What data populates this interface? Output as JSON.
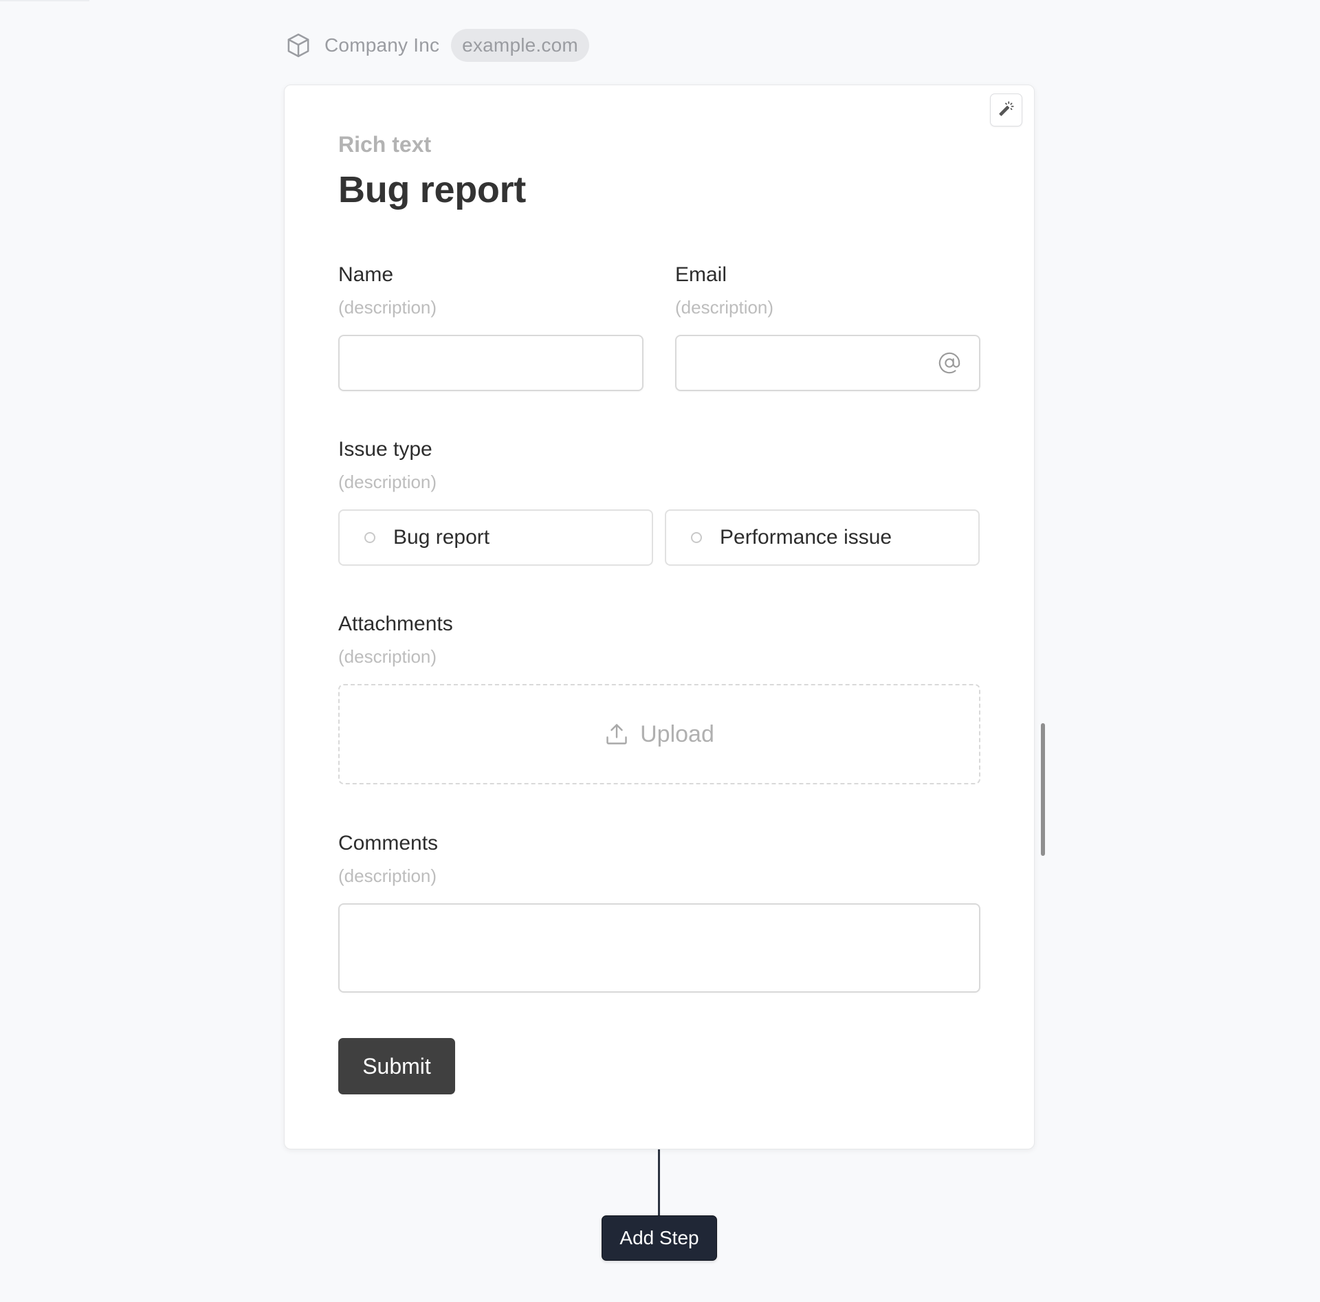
{
  "header": {
    "brand_icon": "cube-icon",
    "company_name": "Company Inc",
    "domain_pill": "example.com"
  },
  "card": {
    "toolbar": {
      "wand_icon": "magic-wand-icon"
    },
    "eyebrow": "Rich text",
    "title": "Bug report",
    "fields": {
      "name": {
        "label": "Name",
        "description": "(description)",
        "value": "",
        "placeholder": ""
      },
      "email": {
        "label": "Email",
        "description": "(description)",
        "value": "",
        "placeholder": "",
        "icon": "at-sign-icon"
      },
      "issue_type": {
        "label": "Issue type",
        "description": "(description)",
        "options": [
          {
            "label": "Bug report",
            "selected": false
          },
          {
            "label": "Performance issue",
            "selected": false
          }
        ]
      },
      "attachments": {
        "label": "Attachments",
        "description": "(description)",
        "upload_label": "Upload",
        "upload_icon": "upload-icon"
      },
      "comments": {
        "label": "Comments",
        "description": "(description)",
        "value": "",
        "placeholder": ""
      }
    },
    "submit_label": "Submit"
  },
  "flow": {
    "add_step_label": "Add Step"
  },
  "colors": {
    "background": "#f8f9fb",
    "card": "#ffffff",
    "submit": "#404040",
    "add_step": "#202736",
    "muted_text": "#9a9ca1"
  }
}
